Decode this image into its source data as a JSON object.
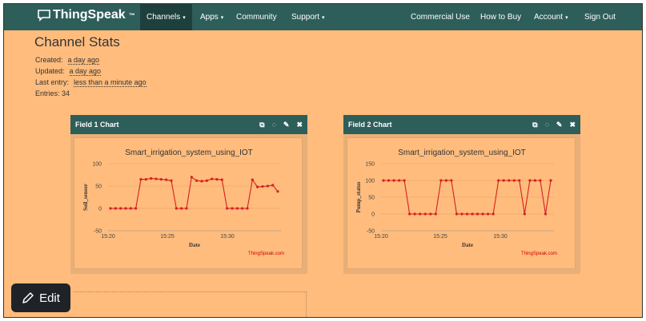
{
  "navbar": {
    "brand": "ThingSpeak",
    "brand_tm": "™",
    "items": [
      {
        "label": "Channels",
        "caret": "▾"
      },
      {
        "label": "Apps",
        "caret": "▾"
      },
      {
        "label": "Community",
        "caret": ""
      },
      {
        "label": "Support",
        "caret": "▾"
      },
      {
        "label": "Commercial Use",
        "caret": ""
      },
      {
        "label": "How to Buy",
        "caret": ""
      },
      {
        "label": "Account",
        "caret": "▾"
      },
      {
        "label": "Sign Out",
        "caret": ""
      }
    ]
  },
  "page": {
    "title": "Channel Stats",
    "created_label": "Created:",
    "created_value": "a day ago",
    "updated_label": "Updated:",
    "updated_value": "a day ago",
    "last_entry_label": "Last entry:",
    "last_entry_value": "less than a minute ago",
    "entries_label": "Entries:",
    "entries_value": "34"
  },
  "panels": [
    {
      "title": "Field 1 Chart"
    },
    {
      "title": "Field 2 Chart"
    }
  ],
  "edit_button": {
    "label": "Edit"
  },
  "colors": {
    "navbar": "#2e5e5a",
    "background": "#ffbc7d",
    "series": "#d62020"
  },
  "chart_data": [
    {
      "type": "line",
      "title": "Smart_irrigation_system_using_IOT",
      "xlabel": "Date",
      "ylabel": "Soil_sensor",
      "x_ticks": [
        "15:20",
        "15:25",
        "15:30"
      ],
      "y_ticks": [
        100,
        50,
        0,
        -50
      ],
      "ylim": [
        -50,
        100
      ],
      "credit": "ThingSpeak.com",
      "series": [
        {
          "values": [
            0,
            0,
            0,
            0,
            0,
            0,
            65,
            65,
            67,
            66,
            65,
            64,
            62,
            0,
            0,
            0,
            70,
            62,
            61,
            62,
            66,
            65,
            64,
            0,
            0,
            0,
            0,
            0,
            64,
            48,
            49,
            50,
            52,
            38
          ]
        }
      ]
    },
    {
      "type": "line",
      "title": "Smart_irrigation_system_using_IOT",
      "xlabel": "Date",
      "ylabel": "Pump_status",
      "x_ticks": [
        "15:20",
        "15:25",
        "15:30"
      ],
      "y_ticks": [
        150,
        100,
        50,
        0,
        -50
      ],
      "ylim": [
        -50,
        150
      ],
      "credit": "ThingSpeak.com",
      "series": [
        {
          "values": [
            100,
            100,
            100,
            100,
            100,
            0,
            0,
            0,
            0,
            0,
            0,
            100,
            100,
            100,
            0,
            0,
            0,
            0,
            0,
            0,
            0,
            0,
            100,
            100,
            100,
            100,
            100,
            0,
            100,
            100,
            100,
            0,
            100
          ]
        }
      ]
    }
  ]
}
